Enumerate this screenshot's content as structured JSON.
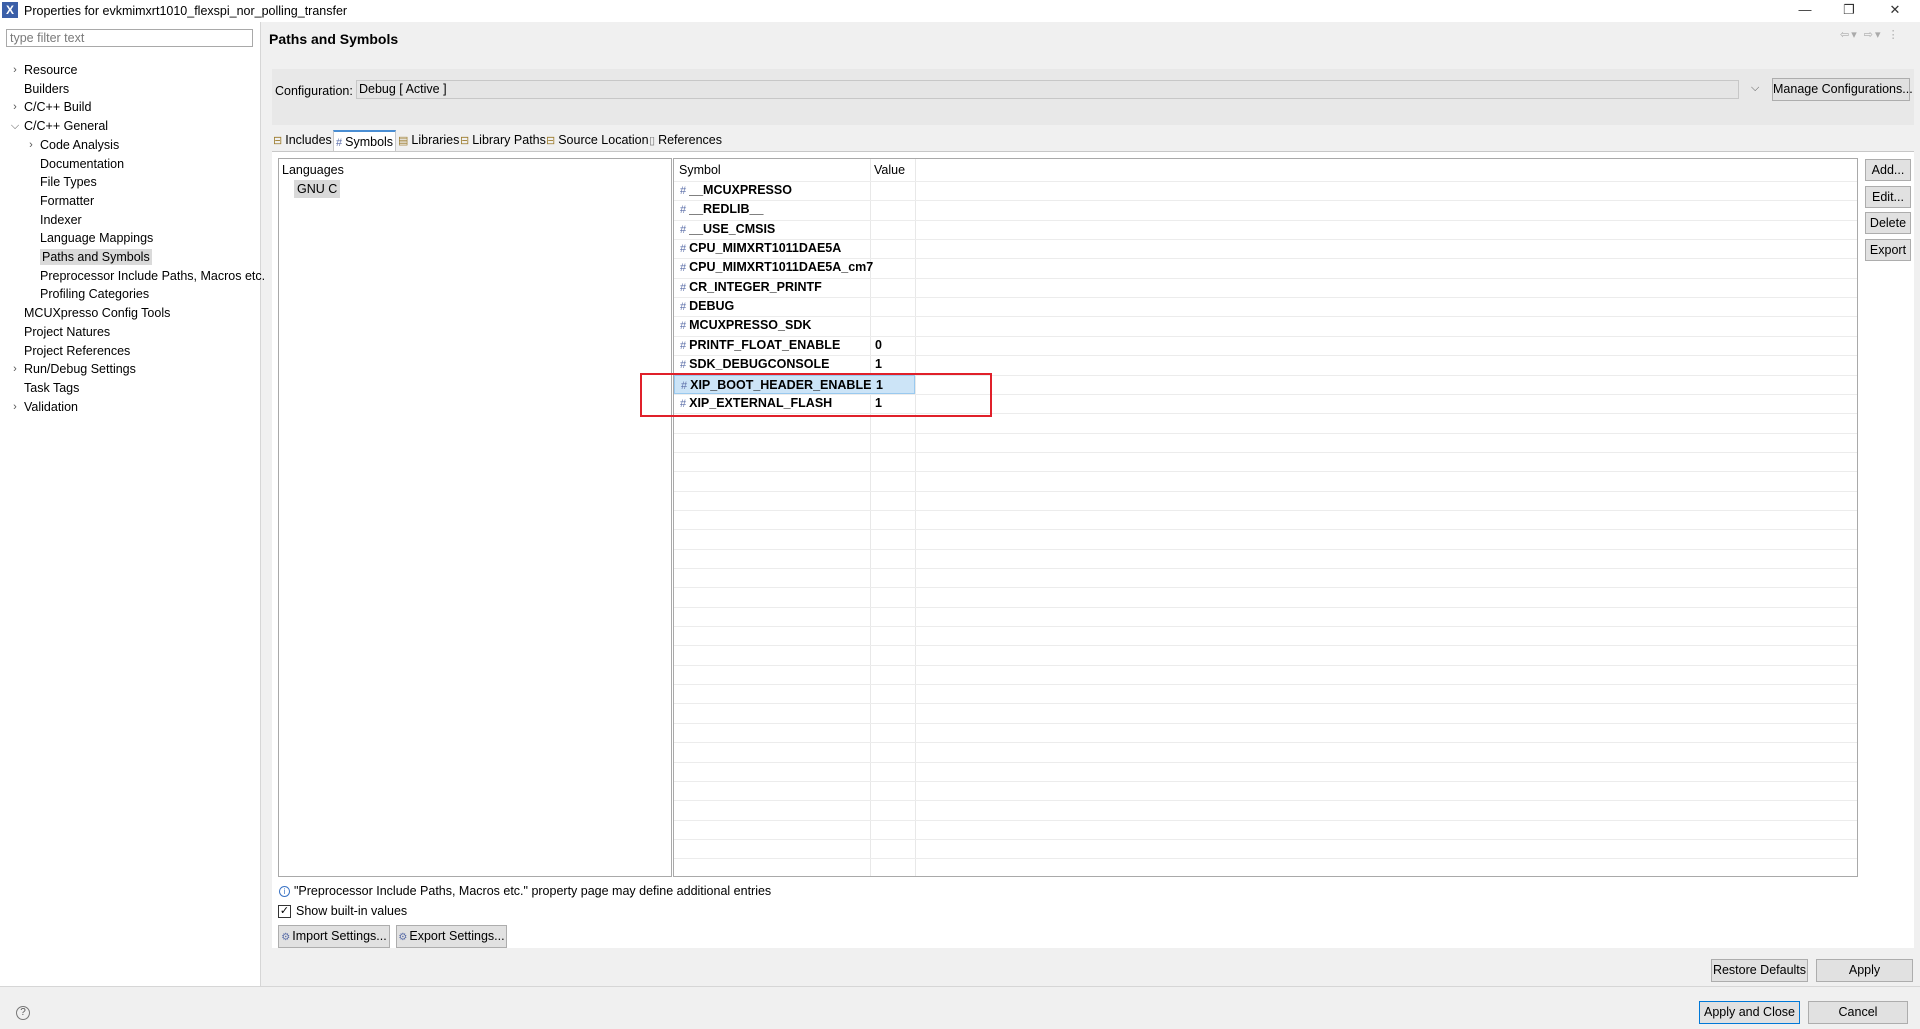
{
  "window": {
    "title": "Properties for evkmimxrt1010_flexspi_nor_polling_transfer",
    "app_icon_glyph": "X",
    "minimize_glyph": "—",
    "restore_glyph": "❐",
    "close_glyph": "✕"
  },
  "filter": {
    "placeholder": "type filter text",
    "value": ""
  },
  "tree": [
    {
      "label": "Resource",
      "expandable": true,
      "expanded": false
    },
    {
      "label": "Builders",
      "expandable": false
    },
    {
      "label": "C/C++ Build",
      "expandable": true,
      "expanded": false
    },
    {
      "label": "C/C++ General",
      "expandable": true,
      "expanded": true
    },
    {
      "label": "Code Analysis",
      "expandable": true,
      "expanded": false
    },
    {
      "label": "Documentation",
      "expandable": false
    },
    {
      "label": "File Types",
      "expandable": false
    },
    {
      "label": "Formatter",
      "expandable": false
    },
    {
      "label": "Indexer",
      "expandable": false
    },
    {
      "label": "Language Mappings",
      "expandable": false
    },
    {
      "label": "Paths and Symbols",
      "expandable": false,
      "selected": true
    },
    {
      "label": "Preprocessor Include Paths, Macros etc.",
      "expandable": false
    },
    {
      "label": "Profiling Categories",
      "expandable": false
    },
    {
      "label": "MCUXpresso Config Tools",
      "expandable": false
    },
    {
      "label": "Project Natures",
      "expandable": false
    },
    {
      "label": "Project References",
      "expandable": false
    },
    {
      "label": "Run/Debug Settings",
      "expandable": true,
      "expanded": false
    },
    {
      "label": "Task Tags",
      "expandable": false
    },
    {
      "label": "Validation",
      "expandable": true,
      "expanded": false
    }
  ],
  "page": {
    "title": "Paths and Symbols",
    "nav_icons": "⇦▾ ⇨▾ ⋮"
  },
  "configuration": {
    "label": "Configuration:",
    "value": "Debug  [ Active ]",
    "manage_button": "Manage Configurations..."
  },
  "tabs": [
    {
      "label": "Includes",
      "icon": "folder-icon",
      "active": false
    },
    {
      "label": "Symbols",
      "icon": "hash-icon",
      "active": true
    },
    {
      "label": "Libraries",
      "icon": "library-icon",
      "active": false
    },
    {
      "label": "Library Paths",
      "icon": "folder-icon",
      "active": false
    },
    {
      "label": "Source Location",
      "icon": "folder-icon",
      "active": false
    },
    {
      "label": "References",
      "icon": "document-icon",
      "active": false
    }
  ],
  "languages": {
    "header": "Languages",
    "items": [
      "GNU C"
    ]
  },
  "symbols_table": {
    "columns": [
      "Symbol",
      "Value"
    ],
    "rows": [
      {
        "symbol": "__MCUXPRESSO",
        "value": ""
      },
      {
        "symbol": "__REDLIB__",
        "value": ""
      },
      {
        "symbol": "__USE_CMSIS",
        "value": ""
      },
      {
        "symbol": "CPU_MIMXRT1011DAE5A",
        "value": ""
      },
      {
        "symbol": "CPU_MIMXRT1011DAE5A_cm7",
        "value": ""
      },
      {
        "symbol": "CR_INTEGER_PRINTF",
        "value": ""
      },
      {
        "symbol": "DEBUG",
        "value": ""
      },
      {
        "symbol": "MCUXPRESSO_SDK",
        "value": ""
      },
      {
        "symbol": "PRINTF_FLOAT_ENABLE",
        "value": "0"
      },
      {
        "symbol": "SDK_DEBUGCONSOLE",
        "value": "1"
      },
      {
        "symbol": "XIP_BOOT_HEADER_ENABLE",
        "value": "1",
        "selected": true
      },
      {
        "symbol": "XIP_EXTERNAL_FLASH",
        "value": "1"
      }
    ]
  },
  "side_buttons": [
    "Add...",
    "Edit...",
    "Delete",
    "Export"
  ],
  "info_note": "\"Preprocessor Include Paths, Macros etc.\" property page may define additional entries",
  "show_builtin": {
    "label": "Show built-in values",
    "checked": true
  },
  "import_button": "Import Settings...",
  "export_button": "Export Settings...",
  "restore_defaults_button": "Restore Defaults",
  "apply_button": "Apply",
  "apply_close_button": "Apply and Close",
  "cancel_button": "Cancel",
  "colors": {
    "highlight_box": "#e0202a",
    "selection": "#cce4f7",
    "tab_accent": "#4a8ed3"
  }
}
